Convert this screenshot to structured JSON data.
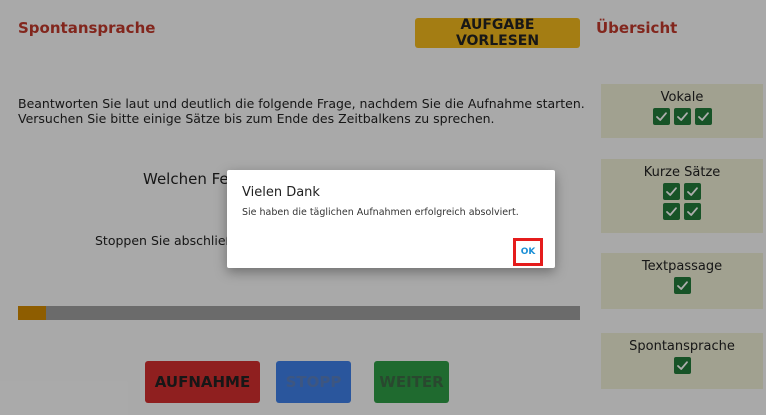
{
  "main": {
    "section_title": "Spontansprache",
    "read_button": "AUFGABE VORLESEN",
    "instructions": "Beantworten Sie laut und deutlich die folgende Frage, nachdem Sie die Aufnahme starten. Versuchen Sie bitte einige Sätze bis zum Ende des Zeitbalkens zu sprechen.",
    "question_visible": "Welchen Fei",
    "stop_hint_visible": "Stoppen Sie abschließ",
    "progress": 0.05,
    "buttons": {
      "record": "AUFNAHME",
      "stop": "STOPP",
      "next": "WEITER"
    }
  },
  "sidebar": {
    "title": "Übersicht",
    "cards": [
      {
        "label": "Vokale",
        "checks": 3
      },
      {
        "label": "Kurze Sätze",
        "checks": 4
      },
      {
        "label": "Textpassage",
        "checks": 1
      },
      {
        "label": "Spontansprache",
        "checks": 1
      }
    ]
  },
  "dialog": {
    "title": "Vielen Dank",
    "message": "Sie haben die täglichen Aufnahmen erfolgreich absolviert.",
    "ok_label": "OK"
  },
  "colors": {
    "accent_red": "#c0392b",
    "read_button": "#f2b81c",
    "record_button": "#d32f2f",
    "stop_button": "#3f7fe8",
    "next_button": "#2e9d46",
    "check_green": "#237b3a",
    "progress_fill": "#d18a00",
    "highlight_box": "#e51c1c"
  },
  "icons": {
    "check": "checkmark-icon"
  }
}
